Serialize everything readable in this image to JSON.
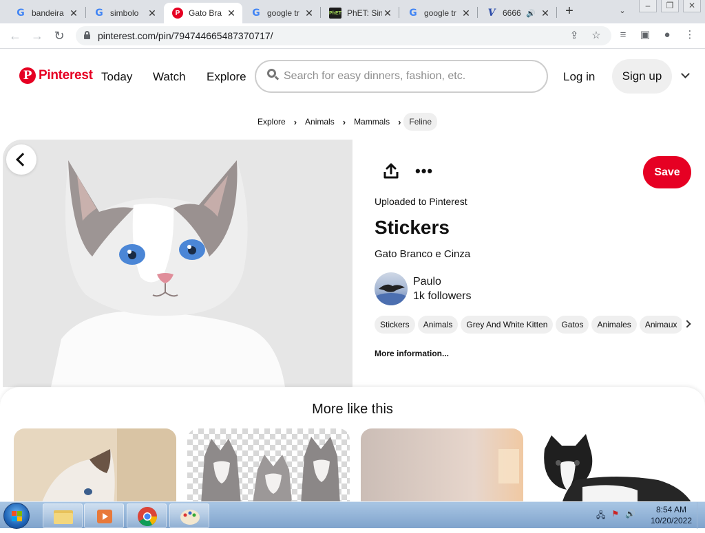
{
  "browser": {
    "tabs": [
      {
        "title": "bandeira",
        "favicon": "google-icon"
      },
      {
        "title": "simbolo",
        "favicon": "google-icon"
      },
      {
        "title": "Gato Bra",
        "favicon": "pinterest-icon",
        "active": true
      },
      {
        "title": "google tr",
        "favicon": "google-icon"
      },
      {
        "title": "PhET: Sim",
        "favicon": "phet-icon"
      },
      {
        "title": "google tr",
        "favicon": "google-icon"
      },
      {
        "title": "6666",
        "favicon": "v-icon",
        "audio": true
      }
    ],
    "url": "pinterest.com/pin/794744665487370717/",
    "phet_favicon_text": "PhET"
  },
  "header": {
    "logo": "Pinterest",
    "nav": [
      "Today",
      "Watch",
      "Explore"
    ],
    "search_placeholder": "Search for easy dinners, fashion, etc.",
    "login": "Log in",
    "signup": "Sign up"
  },
  "breadcrumb": [
    "Explore",
    "Animals",
    "Mammals",
    "Feline"
  ],
  "pin": {
    "save_label": "Save",
    "uploaded": "Uploaded to Pinterest",
    "title": "Stickers",
    "description": "Gato Branco e Cinza",
    "user_name": "Paulo",
    "followers": "1k followers",
    "tags": [
      "Stickers",
      "Animals",
      "Grey And White Kitten",
      "Gatos",
      "Animales",
      "Animaux"
    ],
    "more_info": "More information..."
  },
  "more_like_this": {
    "title": "More like this"
  },
  "taskbar": {
    "time": "8:54 AM",
    "date": "10/20/2022"
  },
  "colors": {
    "brand": "#e60023"
  }
}
